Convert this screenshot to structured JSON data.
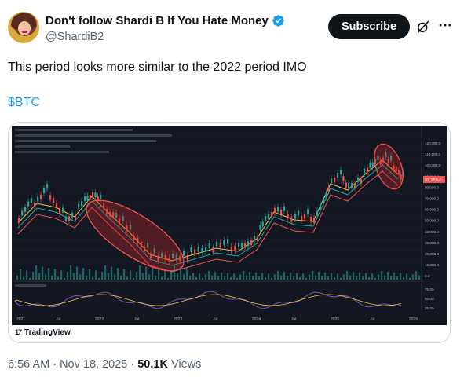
{
  "author": {
    "display_name": "Don't follow Shardi B If You Hate Money",
    "handle": "@ShardiB2"
  },
  "header": {
    "subscribe_label": "Subscribe"
  },
  "icons": {
    "verified": "verified-badge-icon",
    "grok": "grok-icon",
    "more": "more-dots-icon"
  },
  "tweet": {
    "text": "This period looks more similar to the 2022 period IMO",
    "cashtag": "$BTC"
  },
  "meta": {
    "timestamp": "6:56 AM · Nov 18, 2025 · ",
    "views_count": "50.1K",
    "views_label": " Views"
  },
  "colors": {
    "accent": "#1d9bf0",
    "text": "#0f1419",
    "secondary": "#536471",
    "chart_bg": "#131722",
    "up_candle": "#26a69a",
    "down_candle": "#ef5350",
    "highlight": "#c62828"
  },
  "chart": {
    "brand": "TradingView",
    "x_labels": [
      "2021",
      "Jul",
      "2022",
      "Jul",
      "2023",
      "Jul",
      "2024",
      "Jul",
      "2025",
      "Jul",
      "2026"
    ],
    "y_labels": [
      "120,000.0",
      "110,000.0",
      "100,000.0",
      "90,000.0",
      "80,000.0",
      "70,000.0",
      "60,000.0",
      "50,000.0",
      "40,000.0",
      "30,000.0",
      "20,000.0",
      "10,000.0",
      "0.0"
    ],
    "price_tag": "92,259.0",
    "rsi_labels": [
      "75.00",
      "50.00",
      "25.00"
    ]
  }
}
